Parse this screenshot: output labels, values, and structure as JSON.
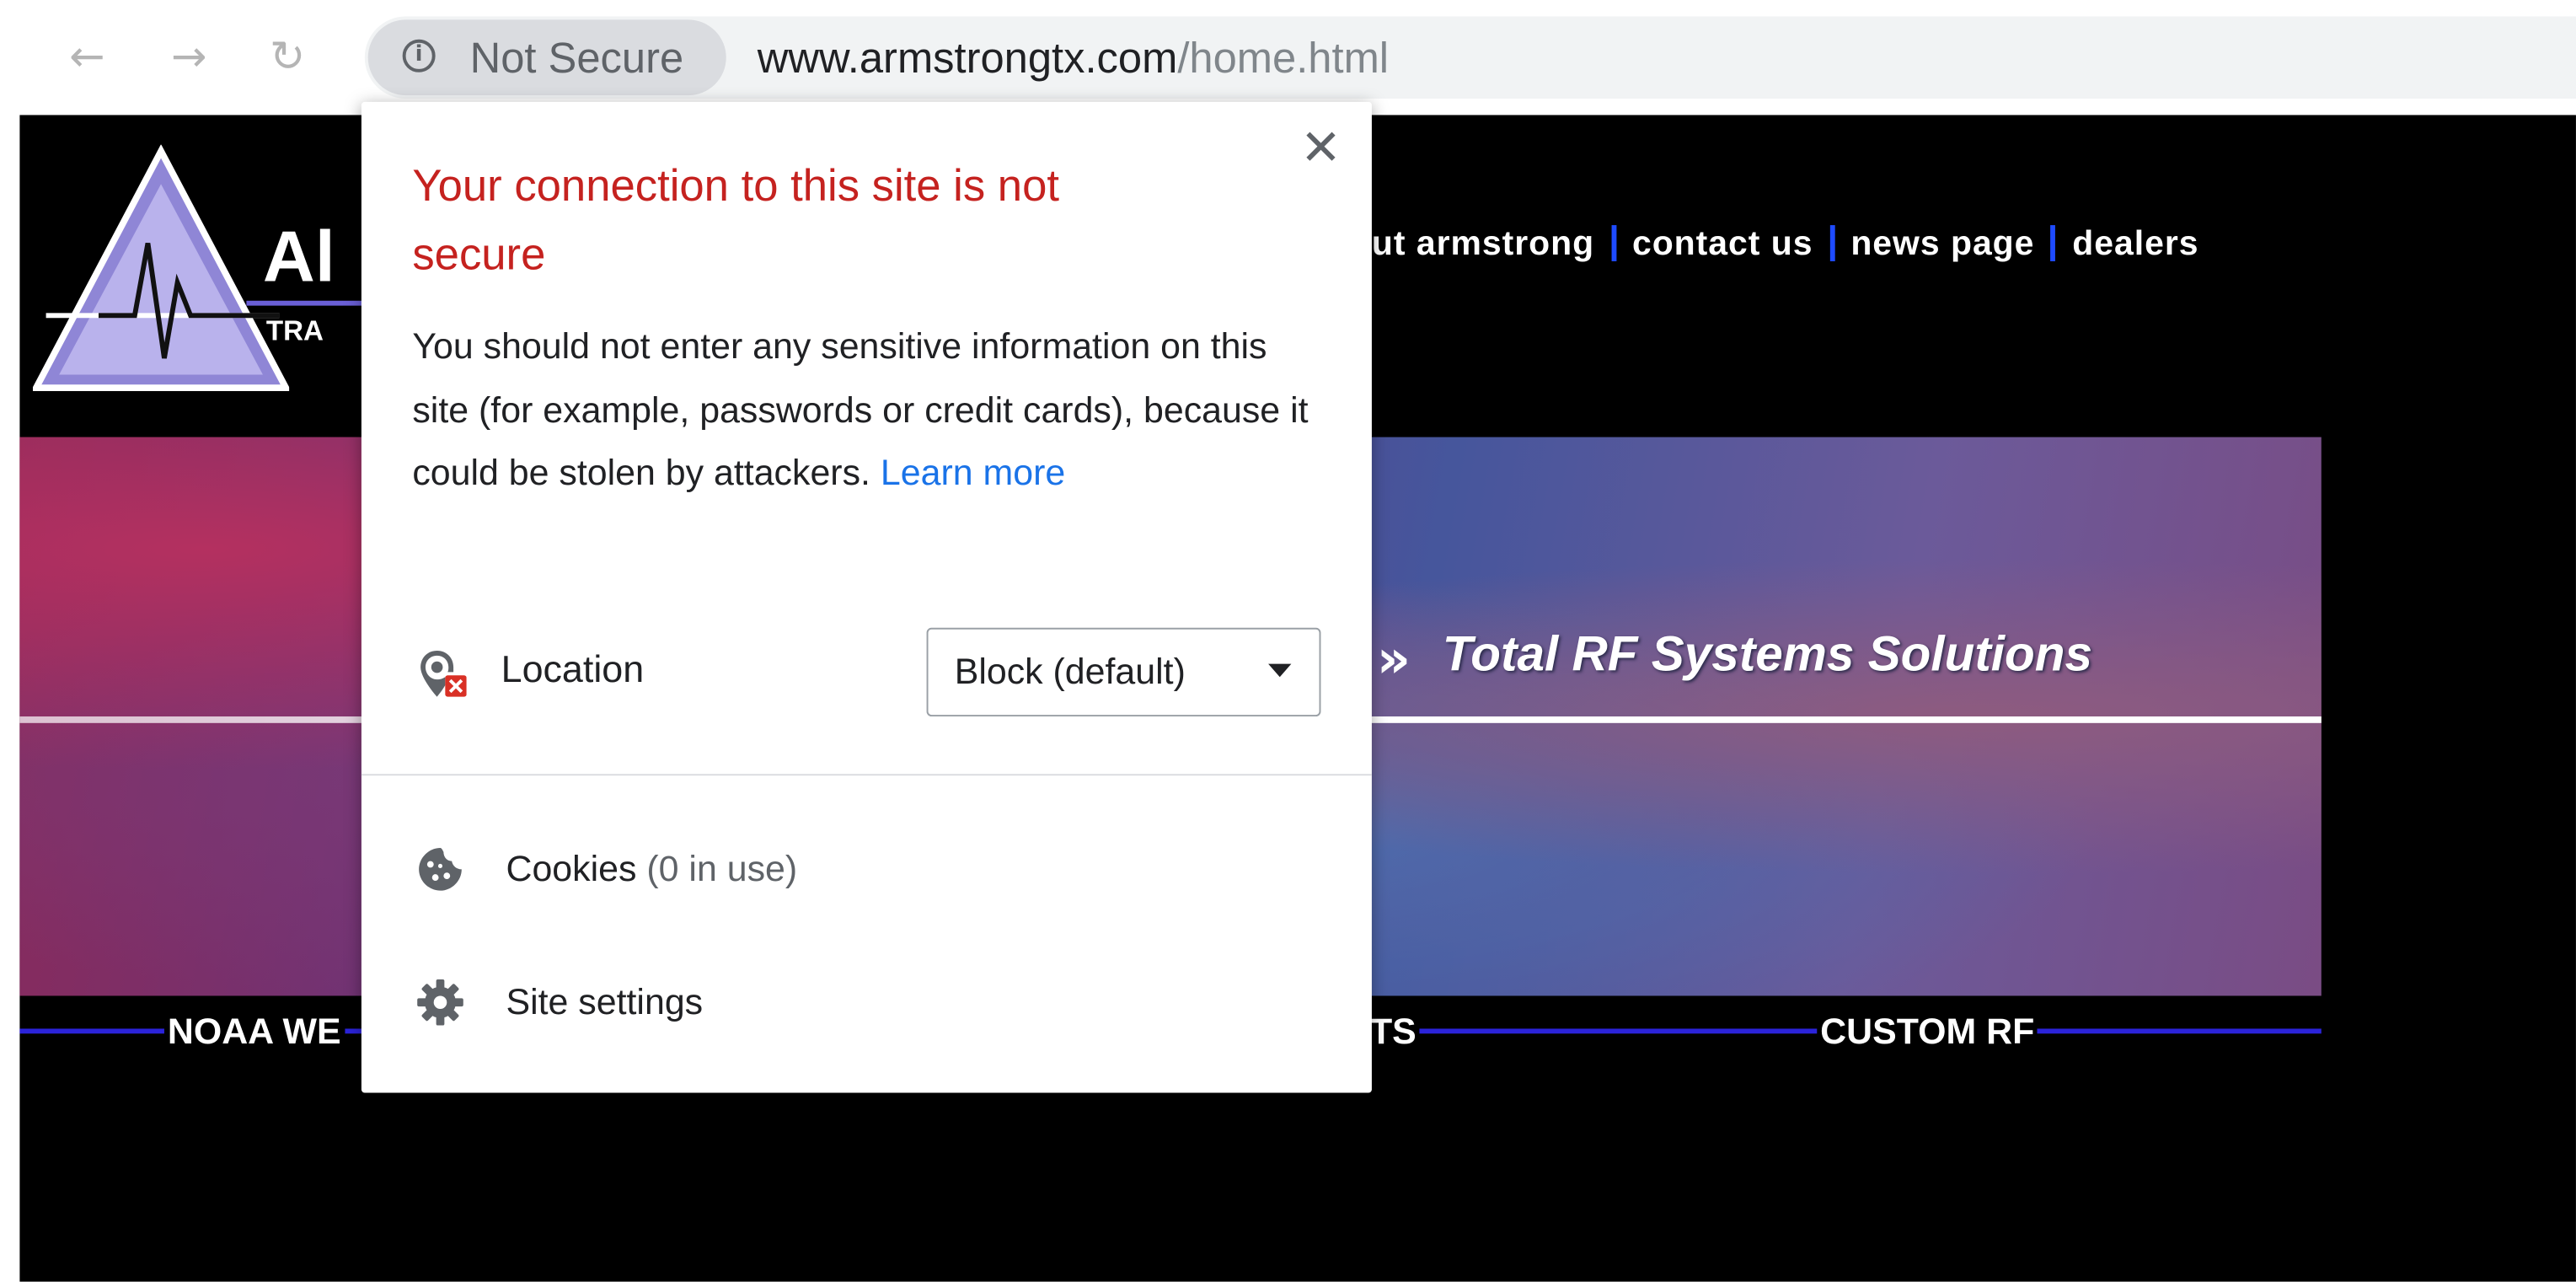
{
  "browser": {
    "nav": {
      "back_icon": "arrow-left-icon",
      "forward_icon": "arrow-right-icon",
      "reload_icon": "reload-icon"
    },
    "security_chip": {
      "icon": "info-icon",
      "label": "Not Secure"
    },
    "url": {
      "host": "www.armstrongtx.com",
      "path": "/home.html"
    }
  },
  "site": {
    "logo_text": "Al",
    "logo_subtext": "TRA",
    "top_nav": [
      "ut armstrong",
      "contact us",
      "news page",
      "dealers"
    ],
    "banner_text": "Total RF Systems Solutions",
    "bottom_nav": [
      "NOAA WE",
      "TS",
      "CUSTOM RF"
    ],
    "colors": {
      "background": "#000000",
      "nav_separator": "#1e4bff",
      "bottom_rule": "#2b23d9"
    }
  },
  "popup": {
    "title": "Your connection to this site is not secure",
    "body": "You should not enter any sensitive information on this site (for example, passwords or credit cards), because it could be stolen by attackers.",
    "learn_more": "Learn more",
    "close_icon": "close-icon",
    "location": {
      "icon": "location-blocked-icon",
      "label": "Location",
      "selected": "Block (default)"
    },
    "cookies": {
      "icon": "cookie-icon",
      "label": "Cookies",
      "count": "(0 in use)"
    },
    "site_settings": {
      "icon": "gear-icon",
      "label": "Site settings"
    },
    "colors": {
      "title": "#c5221f",
      "link": "#1a73e8"
    }
  }
}
